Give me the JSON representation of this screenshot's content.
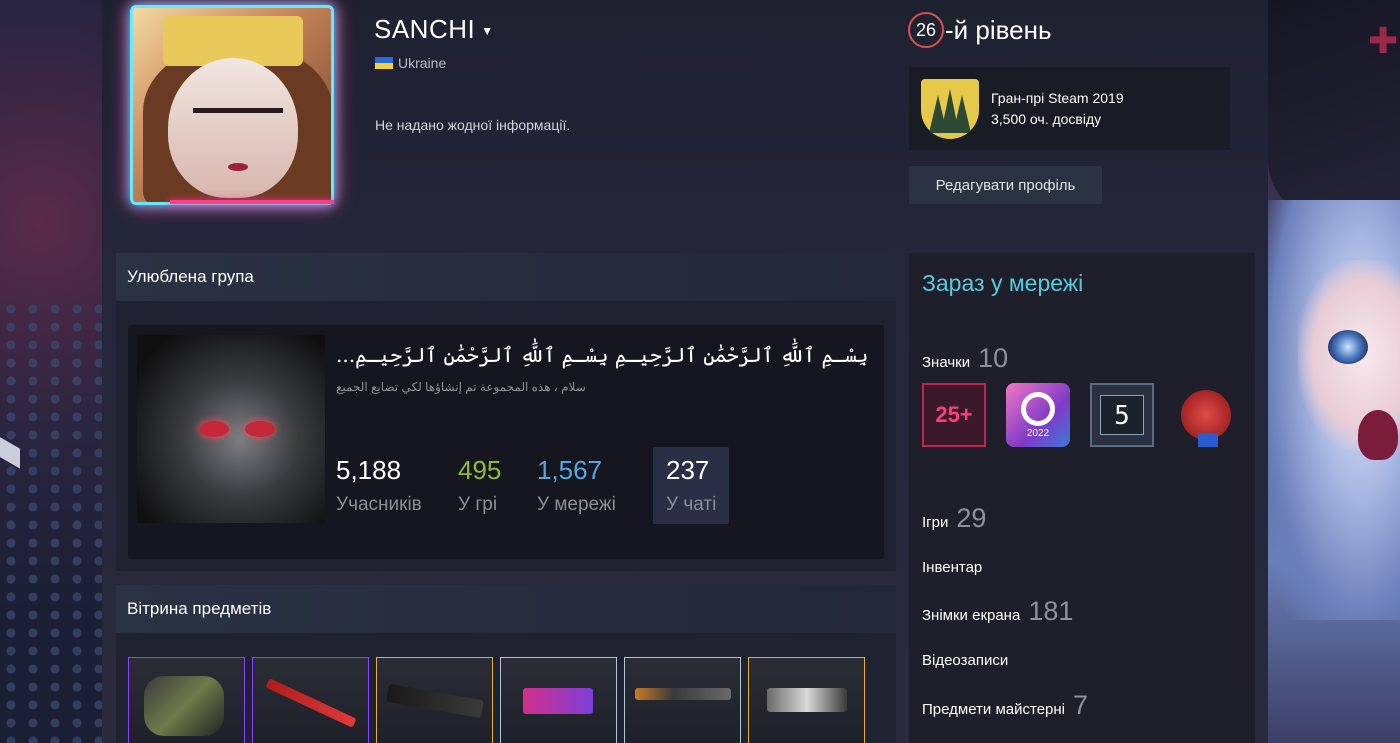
{
  "profile": {
    "username": "SANCHI",
    "country": "Ukraine",
    "summary": "Не надано жодної інформації."
  },
  "level": {
    "number": "26",
    "suffix": "-й рівень"
  },
  "featured_badge": {
    "name": "Гран-прі Steam 2019",
    "xp": "3,500 оч. досвіду"
  },
  "edit_profile_label": "Редагувати профіль",
  "favorite_group": {
    "section_title": "Улюблена група",
    "name": "...بِسْـمِ ٱللَّٰهِ ٱلرَّحْمَٰنِ ٱلرَّحِيـمِ بِسْـمِ ٱللَّٰهِ ٱلرَّحْمَٰنِ ٱلرَّحِيـمِ",
    "subtitle": "سلام ، هذه المجموعة تم إنشاؤها لكي تضايع الجميع",
    "stats": {
      "members": {
        "value": "5,188",
        "label": "Учасників",
        "color": "#ffffff"
      },
      "in_game": {
        "value": "495",
        "label": "У грі",
        "color": "#90ba3c"
      },
      "online": {
        "value": "1,567",
        "label": "У мережі",
        "color": "#57a6e0"
      },
      "in_chat": {
        "value": "237",
        "label": "У чаті",
        "color": "#ffffff"
      }
    }
  },
  "item_showcase": {
    "section_title": "Вітрина предметів",
    "items": [
      {
        "name": "gloves",
        "border": "#8847ff"
      },
      {
        "name": "knife",
        "border": "#8847ff"
      },
      {
        "name": "ak47",
        "border": "#e4ae39"
      },
      {
        "name": "glock",
        "border": "#b0c3d9"
      },
      {
        "name": "usp",
        "border": "#b0c3d9"
      },
      {
        "name": "deagle",
        "border": "#e4ae39"
      }
    ]
  },
  "sidebar": {
    "status": "Зараз у мережі",
    "badges_label": "Значки",
    "badges_count": "10",
    "badges": [
      {
        "name": "25-plus-badge",
        "text": "25+"
      },
      {
        "name": "steam-2022-badge",
        "text": "2022"
      },
      {
        "name": "level-5-badge",
        "text": "5"
      },
      {
        "name": "seal-badge",
        "text": ""
      }
    ],
    "games_label": "Ігри",
    "games_count": "29",
    "inventory_label": "Інвентар",
    "screenshots_label": "Знімки екрана",
    "screenshots_count": "181",
    "videos_label": "Відеозаписи",
    "workshop_label": "Предмети майстерні",
    "workshop_count": "7"
  }
}
